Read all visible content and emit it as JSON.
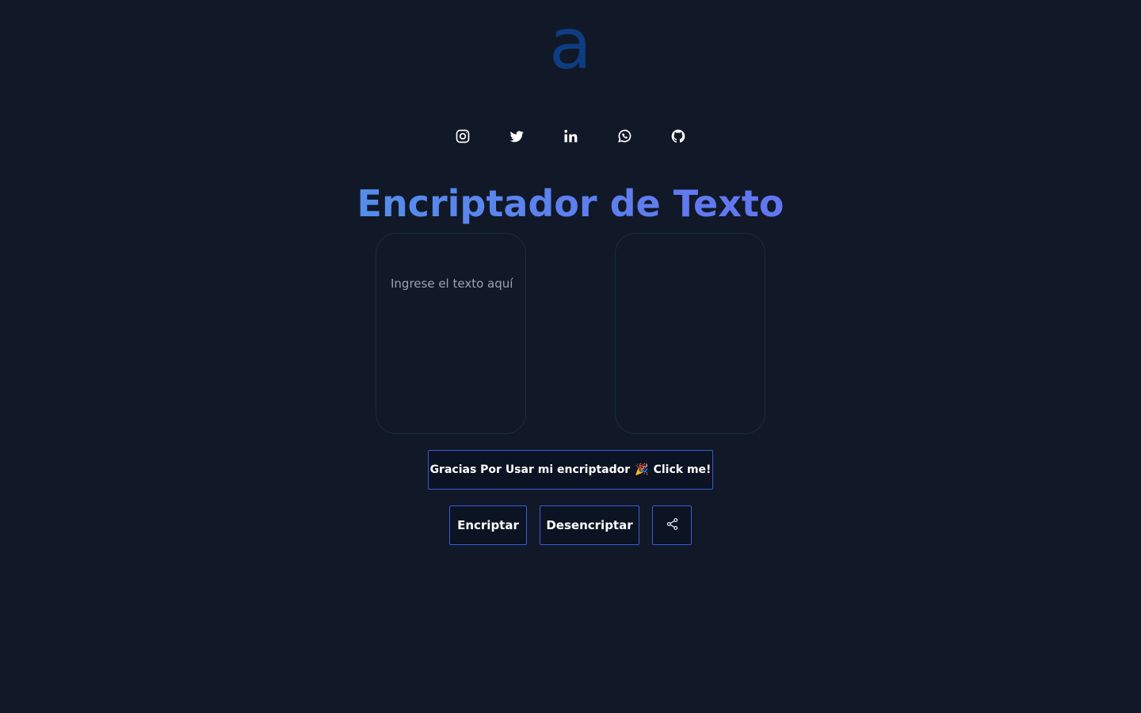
{
  "logo": {
    "glyph": "a",
    "icon": "logo-a-icon",
    "color": "#0f3d82"
  },
  "social": [
    {
      "name": "instagram",
      "icon": "instagram-icon"
    },
    {
      "name": "twitter",
      "icon": "twitter-icon"
    },
    {
      "name": "linkedin",
      "icon": "linkedin-icon"
    },
    {
      "name": "whatsapp",
      "icon": "whatsapp-icon"
    },
    {
      "name": "github",
      "icon": "github-icon"
    }
  ],
  "title": "Encriptador de Texto",
  "title_gradient": [
    "#47a3e3",
    "#6d63f5"
  ],
  "input": {
    "placeholder": "Ingrese el texto aquí",
    "value": ""
  },
  "buttons": {
    "thanks_text": "Gracias Por Usar mi encriptador",
    "thanks_emoji": "🎉",
    "thanks_cta": "Click me!",
    "encrypt": "Encriptar",
    "decrypt": "Desencriptar",
    "share_icon": "share-icon"
  },
  "colors": {
    "background": "#111827",
    "button_border": "#3b5bdb",
    "placeholder": "#9aa3b2"
  }
}
